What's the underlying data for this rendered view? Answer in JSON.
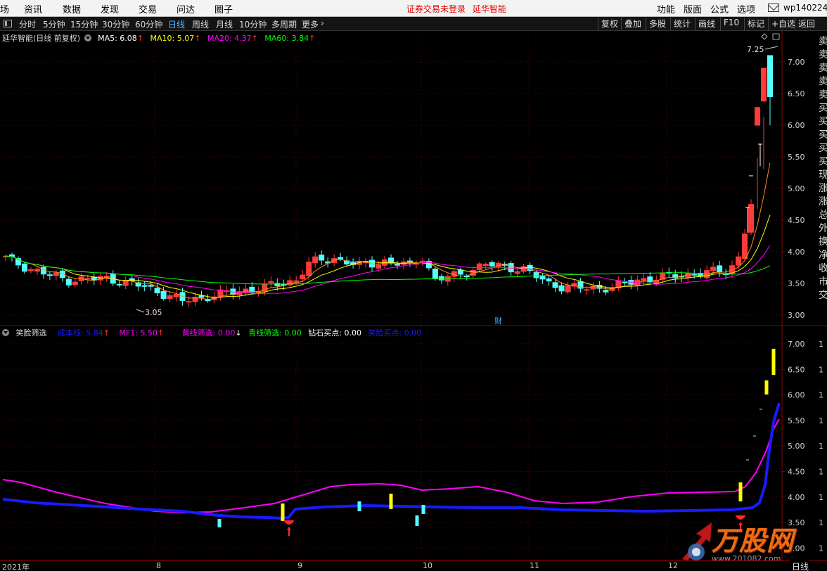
{
  "menu": {
    "items": [
      "场",
      "资讯",
      "数据",
      "发现",
      "交易",
      "问达",
      "圈子"
    ],
    "notice_login": "证券交易未登录",
    "notice_stock": "延华智能",
    "right_items": [
      "功能",
      "版面",
      "公式",
      "选项"
    ],
    "user": "wp140224"
  },
  "toolbar": {
    "periods": [
      "分时",
      "5分钟",
      "15分钟",
      "30分钟",
      "60分钟",
      "日线",
      "周线",
      "月线",
      "10分钟",
      "多周期",
      "更多"
    ],
    "active_period": "日线",
    "right_buttons": [
      "复权",
      "叠加",
      "多股",
      "统计",
      "画线",
      "F10",
      "标记",
      "+自选",
      "返回"
    ]
  },
  "main_chart": {
    "title": "延华智能(日线 前复权)",
    "ma": [
      {
        "label": "MA5: 6.08",
        "color": "#ffffff"
      },
      {
        "label": "MA10: 5.07",
        "color": "#ffff00"
      },
      {
        "label": "MA20: 4.37",
        "color": "#ff00ff"
      },
      {
        "label": "MA60: 3.84",
        "color": "#00ff00"
      }
    ],
    "high_label": "7.25",
    "low_label": "3.05",
    "cai_marker": "财",
    "y_ticks": [
      "7.00",
      "6.50",
      "6.00",
      "5.50",
      "5.00",
      "4.50",
      "4.00",
      "3.50",
      "3.00"
    ]
  },
  "sub_chart": {
    "title": "笑脸筛选",
    "legend": [
      {
        "label": "成本线: 5.84",
        "color": "#1a1aff",
        "arrow": "↑"
      },
      {
        "label": "MF1: 5.50",
        "color": "#ff00ff",
        "arrow": "↑"
      },
      {
        "label": "黄线筛选: 0.00",
        "color": "#ff00ff",
        "arrow": ""
      },
      {
        "label": "↓",
        "color": "#ffffff",
        "arrow": ""
      },
      {
        "label": "青线筛选: 0.00",
        "color": "#00ff00",
        "arrow": ""
      },
      {
        "label": "钻石买点: 0.00",
        "color": "#ffffff",
        "arrow": ""
      },
      {
        "label": "笑脸买点: 0.00",
        "color": "#1a1aff",
        "arrow": ""
      }
    ],
    "y_ticks": [
      "7.00",
      "6.50",
      "6.00",
      "5.50",
      "5.00",
      "4.50",
      "4.00",
      "3.50",
      "3.00"
    ]
  },
  "right_column": [
    "卖",
    "卖",
    "卖",
    "卖",
    "卖",
    "买",
    "买",
    "买",
    "买",
    "买",
    "现",
    "涨",
    "涨",
    "总",
    "外",
    "换",
    "净",
    "收",
    "市",
    "交"
  ],
  "x_axis": {
    "labels": [
      "2021年",
      "8",
      "9",
      "10",
      "11",
      "12"
    ],
    "period": "日线"
  },
  "watermark": {
    "brand": "万股网",
    "url": "www.201082.com"
  },
  "colors": {
    "up": "#ff3a3a",
    "down": "#54ffff",
    "cost_line": "#1a1aff",
    "mf1_line": "#ff00ff",
    "axis": "#8b0000"
  }
}
